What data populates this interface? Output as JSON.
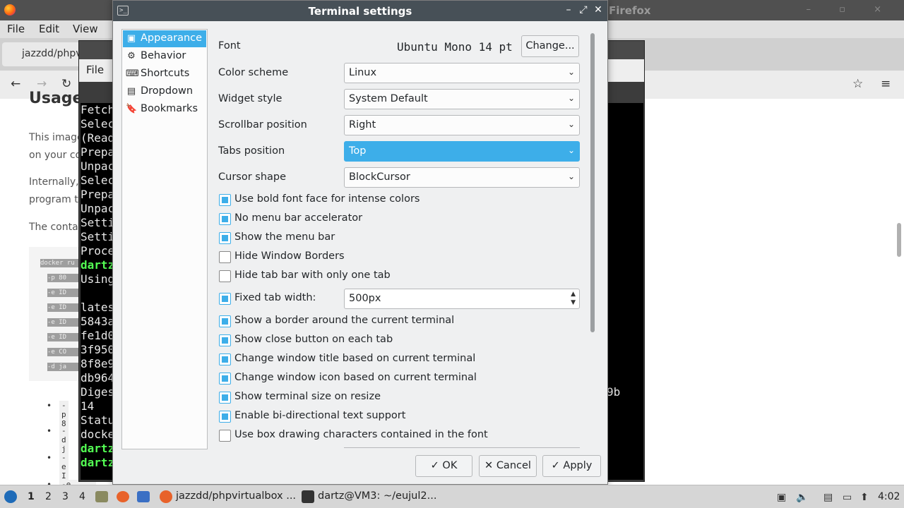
{
  "firefox": {
    "title": "Firefox",
    "menu": [
      "File",
      "Edit",
      "View"
    ],
    "tab_label": "jazzdd/phpv",
    "page_heading": "Usage",
    "paragraphs": [
      "This image",
      "on your co",
      "Internally,",
      "program th",
      "The contai"
    ],
    "code_lines": [
      "docker ru",
      "-p 80",
      "-e ID",
      "-e ID",
      "-e ID",
      "-e ID",
      "-e CO",
      "-d ja"
    ],
    "bullets": [
      "-p 8",
      "-d j",
      "-e I",
      "-e ID_PORT"
    ]
  },
  "terminal": {
    "menu_file": "File",
    "lines": [
      "Fetch",
      "Selec",
      "(Read",
      "Prepa",
      "Unpac",
      "Selec",
      "Prepa",
      "Unpac",
      "Setti",
      "Setti",
      "Proce",
      "dartz",
      "Using",
      "",
      "lates",
      "5843a",
      "fe1d0",
      "3f950",
      "8f8e9",
      "db964",
      "Diges",
      "14",
      "Statu",
      "docke",
      "dartz",
      "dartz"
    ],
    "hash_suffix": "9b"
  },
  "dialog": {
    "title": "Terminal settings",
    "sidebar": [
      {
        "label": "Appearance",
        "icon": "appearance-icon",
        "glyph": "▣"
      },
      {
        "label": "Behavior",
        "icon": "behavior-icon",
        "glyph": "⚙"
      },
      {
        "label": "Shortcuts",
        "icon": "keyboard-icon",
        "glyph": "⌨"
      },
      {
        "label": "Dropdown",
        "icon": "dropdown-icon",
        "glyph": "▤"
      },
      {
        "label": "Bookmarks",
        "icon": "bookmark-icon",
        "glyph": "🔖"
      }
    ],
    "font": {
      "label": "Font",
      "value": "Ubuntu Mono 14 pt",
      "button": "Change..."
    },
    "selects": [
      {
        "label": "Color scheme",
        "value": "Linux"
      },
      {
        "label": "Widget style",
        "value": "System Default"
      },
      {
        "label": "Scrollbar position",
        "value": "Right"
      },
      {
        "label": "Tabs position",
        "value": "Top"
      },
      {
        "label": "Cursor shape",
        "value": "BlockCursor"
      }
    ],
    "checks": [
      {
        "label": "Use bold font face for intense colors",
        "checked": true
      },
      {
        "label": "No menu bar accelerator",
        "checked": true
      },
      {
        "label": "Show the menu bar",
        "checked": true
      },
      {
        "label": "Hide Window Borders",
        "checked": false
      },
      {
        "label": "Hide tab bar with only one tab",
        "checked": false
      },
      {
        "label": "Fixed tab width:",
        "checked": true
      },
      {
        "label": "Show a border around the current terminal",
        "checked": true
      },
      {
        "label": "Show close button on each tab",
        "checked": true
      },
      {
        "label": "Change window title based on current terminal",
        "checked": true
      },
      {
        "label": "Change window icon based on current terminal",
        "checked": true
      },
      {
        "label": "Show terminal size on resize",
        "checked": true
      },
      {
        "label": "Enable bi-directional text support",
        "checked": true
      },
      {
        "label": "Use box drawing characters contained in the font",
        "checked": false
      }
    ],
    "tab_width_value": "500px",
    "buttons": {
      "ok": "OK",
      "cancel": "Cancel",
      "apply": "Apply"
    }
  },
  "taskbar": {
    "workspaces": [
      "1",
      "2",
      "3",
      "4"
    ],
    "tasks": [
      "jazzdd/phpvirtualbox ...",
      "dartz@VM3: ~/eujul2..."
    ],
    "clock": "4:02"
  },
  "colors": {
    "accent": "#3daee9",
    "titlebar": "#475057"
  }
}
